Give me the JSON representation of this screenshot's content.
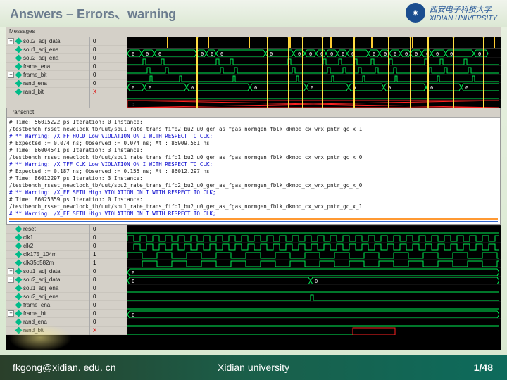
{
  "header": {
    "title": "Answers – Errors、warning",
    "logo_sub": "XIDIAN UNIVERSITY",
    "logo_cn": "西安电子科技大学"
  },
  "panel1": {
    "header": "Messages",
    "signals": [
      {
        "name": "sou2_adj_data",
        "exp": "+",
        "val": "0"
      },
      {
        "name": "sou1_adj_ena",
        "exp": "",
        "val": "0"
      },
      {
        "name": "sou2_adj_ena",
        "exp": "",
        "val": "0"
      },
      {
        "name": "frame_ena",
        "exp": "",
        "val": "0"
      },
      {
        "name": "frame_bit",
        "exp": "+",
        "val": "0"
      },
      {
        "name": "rand_ena",
        "exp": "",
        "val": "0"
      },
      {
        "name": "rand_bit",
        "exp": "",
        "val": "X"
      }
    ]
  },
  "transcript": {
    "header": "Transcript",
    "lines": [
      "# Time: 56015222 ps Iteration: 0 Instance: /testbench_rsset_newclock_tb/uut/sou1_rate_trans_fifo2_bu2_u0_gen_as_fgas_normgen_fblk_dkmod_cx_wrx_pntr_gc_x_1",
      "# ** Warning: /X_FF HOLD Low VIOLATION ON I WITH RESPECT TO CLK;",
      "#   Expected := 0.074 ns; Observed := 0.074 ns; At : 85909.561 ns",
      "# Time: 86004541 ps Iteration: 3 Instance: /testbench_rsset_newclock_tb/uut/sou1_rate_trans_fifo1_bu2_u0_gen_as_fgas_normgen_fblk_dkmod_cx_wrx_pntr_gc_x_0",
      "# ** Warning: /X_TFF CLK Low VIOLATION ON I WITH RESPECT TO CLK;",
      "#   Expected := 0.187 ns; Observed := 0.155 ns; At : 86012.297 ns",
      "# Time: 86012297 ps Iteration: 3 Instance: /testbench_rsset_newclock_tb/uut/sou2_rate_trans_fifo2_bu2_u0_gen_as_fgas_normgen_fblk_dkmod_cx_wrx_pntr_gc_x_0",
      "# ** Warning: /X_FF SETU High VIOLATION ON I WITH RESPECT TO CLK;",
      "# Time: 86025359 ps Iteration: 0 Instance: /testbench_rsset_newclock_tb/uut/sou1_rate_trans_fifo1_bu2_u0_gen_as_fgas_normgen_fblk_dkmod_cx_wrx_pntr_gc_x_1",
      "# ** Warning: /X_FF SETU High VIOLATION ON I WITH RESPECT TO CLK;"
    ]
  },
  "panel2": {
    "signals": [
      {
        "name": "reset",
        "exp": "",
        "val": "0"
      },
      {
        "name": "clk1",
        "exp": "",
        "val": "0"
      },
      {
        "name": "clk2",
        "exp": "",
        "val": "0"
      },
      {
        "name": "clk175_104m",
        "exp": "",
        "val": "1"
      },
      {
        "name": "clk35p582m",
        "exp": "",
        "val": "1"
      },
      {
        "name": "sou1_adj_data",
        "exp": "+",
        "val": "0"
      },
      {
        "name": "sou2_adj_data",
        "exp": "+",
        "val": "0"
      },
      {
        "name": "sou1_adj_ena",
        "exp": "",
        "val": "0"
      },
      {
        "name": "sou2_adj_ena",
        "exp": "",
        "val": "0"
      },
      {
        "name": "frame_ena",
        "exp": "",
        "val": "0"
      },
      {
        "name": "frame_bit",
        "exp": "+",
        "val": "0"
      },
      {
        "name": "rand_ena",
        "exp": "",
        "val": "0"
      },
      {
        "name": "rand_bit",
        "exp": "",
        "val": "X"
      }
    ]
  },
  "waveforms": {
    "cursor_positions": [
      270,
      370,
      400,
      420,
      448,
      493,
      542,
      573,
      598,
      634,
      677
    ],
    "bus_color": "#00ee55",
    "clock_color": "#00ee55",
    "x_color": "#ff2222"
  },
  "footer": {
    "email": "fkgong@xidian. edu. cn",
    "university": "Xidian university",
    "page": "1/48"
  }
}
